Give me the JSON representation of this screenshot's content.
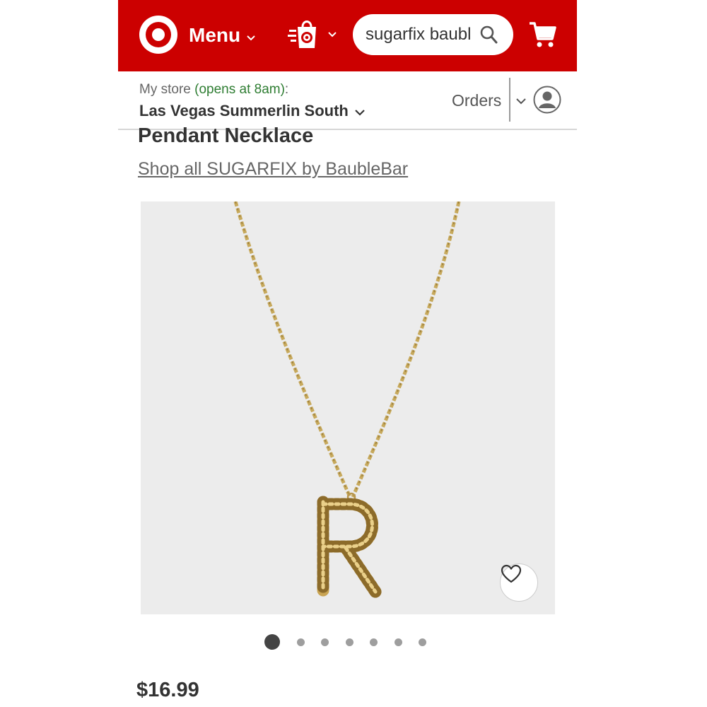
{
  "header": {
    "logo": "target-logo-icon",
    "menu_label": "Menu",
    "search_value": "sugarfix baublebar",
    "search_icon": "search-icon",
    "cart_icon": "cart-icon",
    "bag_icon": "shopping-bag-icon",
    "brand_color": "#cc0000"
  },
  "store": {
    "prefix": "My store ",
    "status": "(opens at 8am)",
    "suffix": ":",
    "name": "Las Vegas Summerlin South",
    "status_color": "#2e7d32"
  },
  "account": {
    "orders_label": "Orders",
    "avatar_icon": "user-icon"
  },
  "product": {
    "title": "Pendant Necklace",
    "shop_link": "Shop all SUGARFIX by BaubleBar",
    "price": "$16.99",
    "favorite_icon": "heart-icon",
    "pendant_letter": "R"
  },
  "carousel": {
    "total": 7,
    "active_index": 0
  }
}
